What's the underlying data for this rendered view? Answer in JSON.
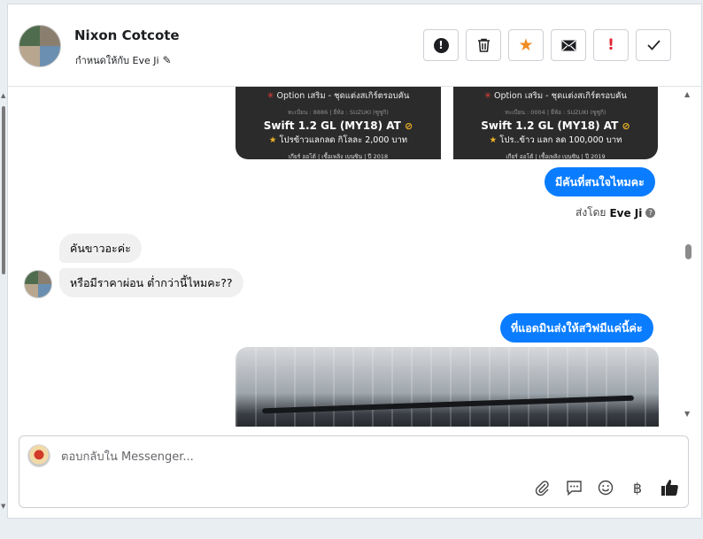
{
  "header": {
    "contact_name": "Nixon Cotcote",
    "assigned_to": "กำหนดให้กับ Eve Ji",
    "actions": [
      {
        "name": "report-button",
        "icon": "exclamation-circle-icon"
      },
      {
        "name": "delete-button",
        "icon": "trash-icon"
      },
      {
        "name": "star-button",
        "icon": "star-icon"
      },
      {
        "name": "mark-unread-button",
        "icon": "envelope-icon"
      },
      {
        "name": "important-button",
        "icon": "exclamation-icon"
      },
      {
        "name": "done-button",
        "icon": "checkmark-icon"
      }
    ]
  },
  "cards": [
    {
      "option": "Option เสริม - ชุดแต่งสเกิร์ตรอบคัน",
      "spec": "ทะเบียน : 8886 | ยี่ห้อ : SUZUKI (ซูซูกิ)",
      "model": "Swift 1.2 GL (MY18) AT",
      "promo": "โปรข้าวแลกลด กิโลละ 2,000 บาท",
      "footer": "เกียร์ ออโต้ | เชื้อเพลิง เบนซิน | ปี 2018"
    },
    {
      "option": "Option เสริม - ชุดแต่งสเกิร์ตรอบคัน",
      "spec": "ทะเบียน : 0004 | ยี่ห้อ : SUZUKI (ซูซูกิ)",
      "model": "Swift 1.2 GL (MY18) AT",
      "promo": "โปร..ข้าว แลก ลด 100,000 บาท",
      "footer": "เกียร์ ออโต้ | เชื้อเพลิง เบนซิน | ปี 2019"
    }
  ],
  "messages": {
    "out1": "มีคันที่สนใจไหมคะ",
    "sent_by_prefix": "ส่งโดย",
    "sent_by_name": "Eve Ji",
    "in1": "คันขาวอะค่ะ",
    "in2": "หรือมีราคาผ่อน ต่ำกว่านี้ไหมคะ??",
    "out2": "ที่แอดมินส่งให้สวิฟมีแค่นี้ค่ะ"
  },
  "composer": {
    "placeholder": "ตอบกลับใน Messenger...",
    "tools": [
      "paperclip-icon",
      "speech-bubble-icon",
      "smiley-icon",
      "baht-icon",
      "thumbs-up-icon"
    ]
  },
  "colors": {
    "outgoing_bubble": "#0a7cff",
    "incoming_bubble": "#f0f0f0",
    "star_accent": "#f08c22",
    "alert_red": "#e0272f"
  }
}
